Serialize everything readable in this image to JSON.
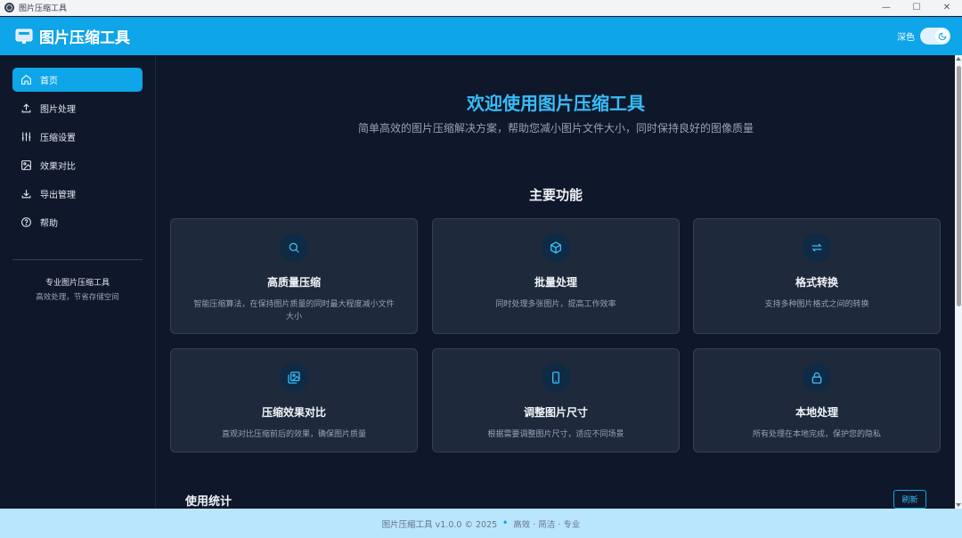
{
  "window": {
    "title": "图片压缩工具",
    "controls": {
      "minimize": "—",
      "maximize": "☐",
      "close": "✕"
    }
  },
  "header": {
    "title": "图片压缩工具",
    "theme_label": "深色",
    "theme_on": true,
    "accent": "#0ea5e9"
  },
  "sidebar": {
    "items": [
      {
        "label": "首页",
        "icon": "home-icon",
        "active": true
      },
      {
        "label": "图片处理",
        "icon": "upload-icon",
        "active": false
      },
      {
        "label": "压缩设置",
        "icon": "sliders-icon",
        "active": false
      },
      {
        "label": "效果对比",
        "icon": "images-icon",
        "active": false
      },
      {
        "label": "导出管理",
        "icon": "download-icon",
        "active": false
      },
      {
        "label": "帮助",
        "icon": "help-circle-icon",
        "active": false
      }
    ],
    "footer_title": "专业图片压缩工具",
    "footer_sub": "高效处理，节省存储空间"
  },
  "main": {
    "hero_title": "欢迎使用图片压缩工具",
    "hero_sub": "简单高效的图片压缩解决方案，帮助您减小图片文件大小，同时保持良好的图像质量",
    "section_title": "主要功能",
    "features": [
      {
        "title": "高质量压缩",
        "desc": "智能压缩算法，在保持图片质量的同时最大程度减小文件大小",
        "icon": "search-icon"
      },
      {
        "title": "批量处理",
        "desc": "同时处理多张图片，提高工作效率",
        "icon": "cube-icon"
      },
      {
        "title": "格式转换",
        "desc": "支持多种图片格式之间的转换",
        "icon": "swap-icon"
      },
      {
        "title": "压缩效果对比",
        "desc": "直观对比压缩前后的效果，确保图片质量",
        "icon": "compare-images-icon"
      },
      {
        "title": "调整图片尺寸",
        "desc": "根据需要调整图片尺寸，适应不同场景",
        "icon": "phone-icon"
      },
      {
        "title": "本地处理",
        "desc": "所有处理在本地完成，保护您的隐私",
        "icon": "lock-icon"
      }
    ],
    "stats_title": "使用统计",
    "refresh_label": "刷新"
  },
  "footer": {
    "left": "图片压缩工具 v1.0.0 © 2025",
    "separator": "•",
    "right": "高效 · 简洁 · 专业"
  }
}
